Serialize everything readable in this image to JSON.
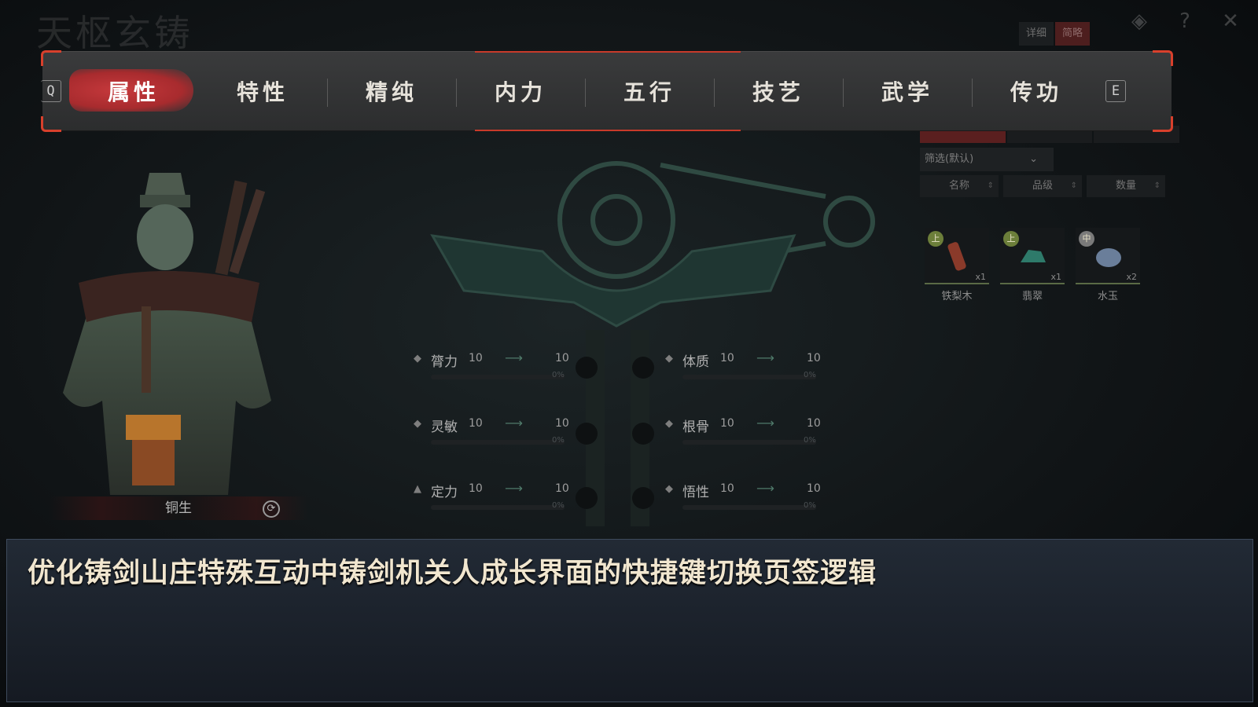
{
  "header": {
    "scene_title": "天枢玄铸",
    "icons": [
      "eye-icon",
      "help-icon",
      "close-icon"
    ]
  },
  "tabbar": {
    "prev_key": "Q",
    "next_key": "E",
    "accent_color": "#c83a2a",
    "tabs": [
      {
        "label": "属性",
        "active": true
      },
      {
        "label": "特性",
        "active": false
      },
      {
        "label": "精纯",
        "active": false
      },
      {
        "label": "内力",
        "active": false
      },
      {
        "label": "五行",
        "active": false
      },
      {
        "label": "技艺",
        "active": false
      },
      {
        "label": "武学",
        "active": false
      },
      {
        "label": "传功",
        "active": false
      }
    ]
  },
  "character": {
    "name": "铜生"
  },
  "stats": {
    "left": [
      {
        "name": "膂力",
        "from": "10",
        "to": "10",
        "percent": "0%"
      },
      {
        "name": "灵敏",
        "from": "10",
        "to": "10",
        "percent": "0%"
      },
      {
        "name": "定力",
        "from": "10",
        "to": "10",
        "percent": "0%"
      }
    ],
    "right": [
      {
        "name": "体质",
        "from": "10",
        "to": "10",
        "percent": "0%"
      },
      {
        "name": "根骨",
        "from": "10",
        "to": "10",
        "percent": "0%"
      },
      {
        "name": "悟性",
        "from": "10",
        "to": "10",
        "percent": "0%"
      }
    ]
  },
  "inventory": {
    "filter": "筛选(默认)",
    "detail_label": "详细",
    "brief_label": "简略",
    "sort": [
      "名称",
      "品级",
      "数量"
    ],
    "items": [
      {
        "grade": "上",
        "name": "铁梨木",
        "count": "x1"
      },
      {
        "grade": "上",
        "name": "翡翠",
        "count": "x1"
      },
      {
        "grade": "中",
        "name": "水玉",
        "count": "x2"
      }
    ]
  },
  "caption": {
    "text": "优化铸剑山庄特殊互动中铸剑机关人成长界面的快捷键切换页签逻辑"
  }
}
